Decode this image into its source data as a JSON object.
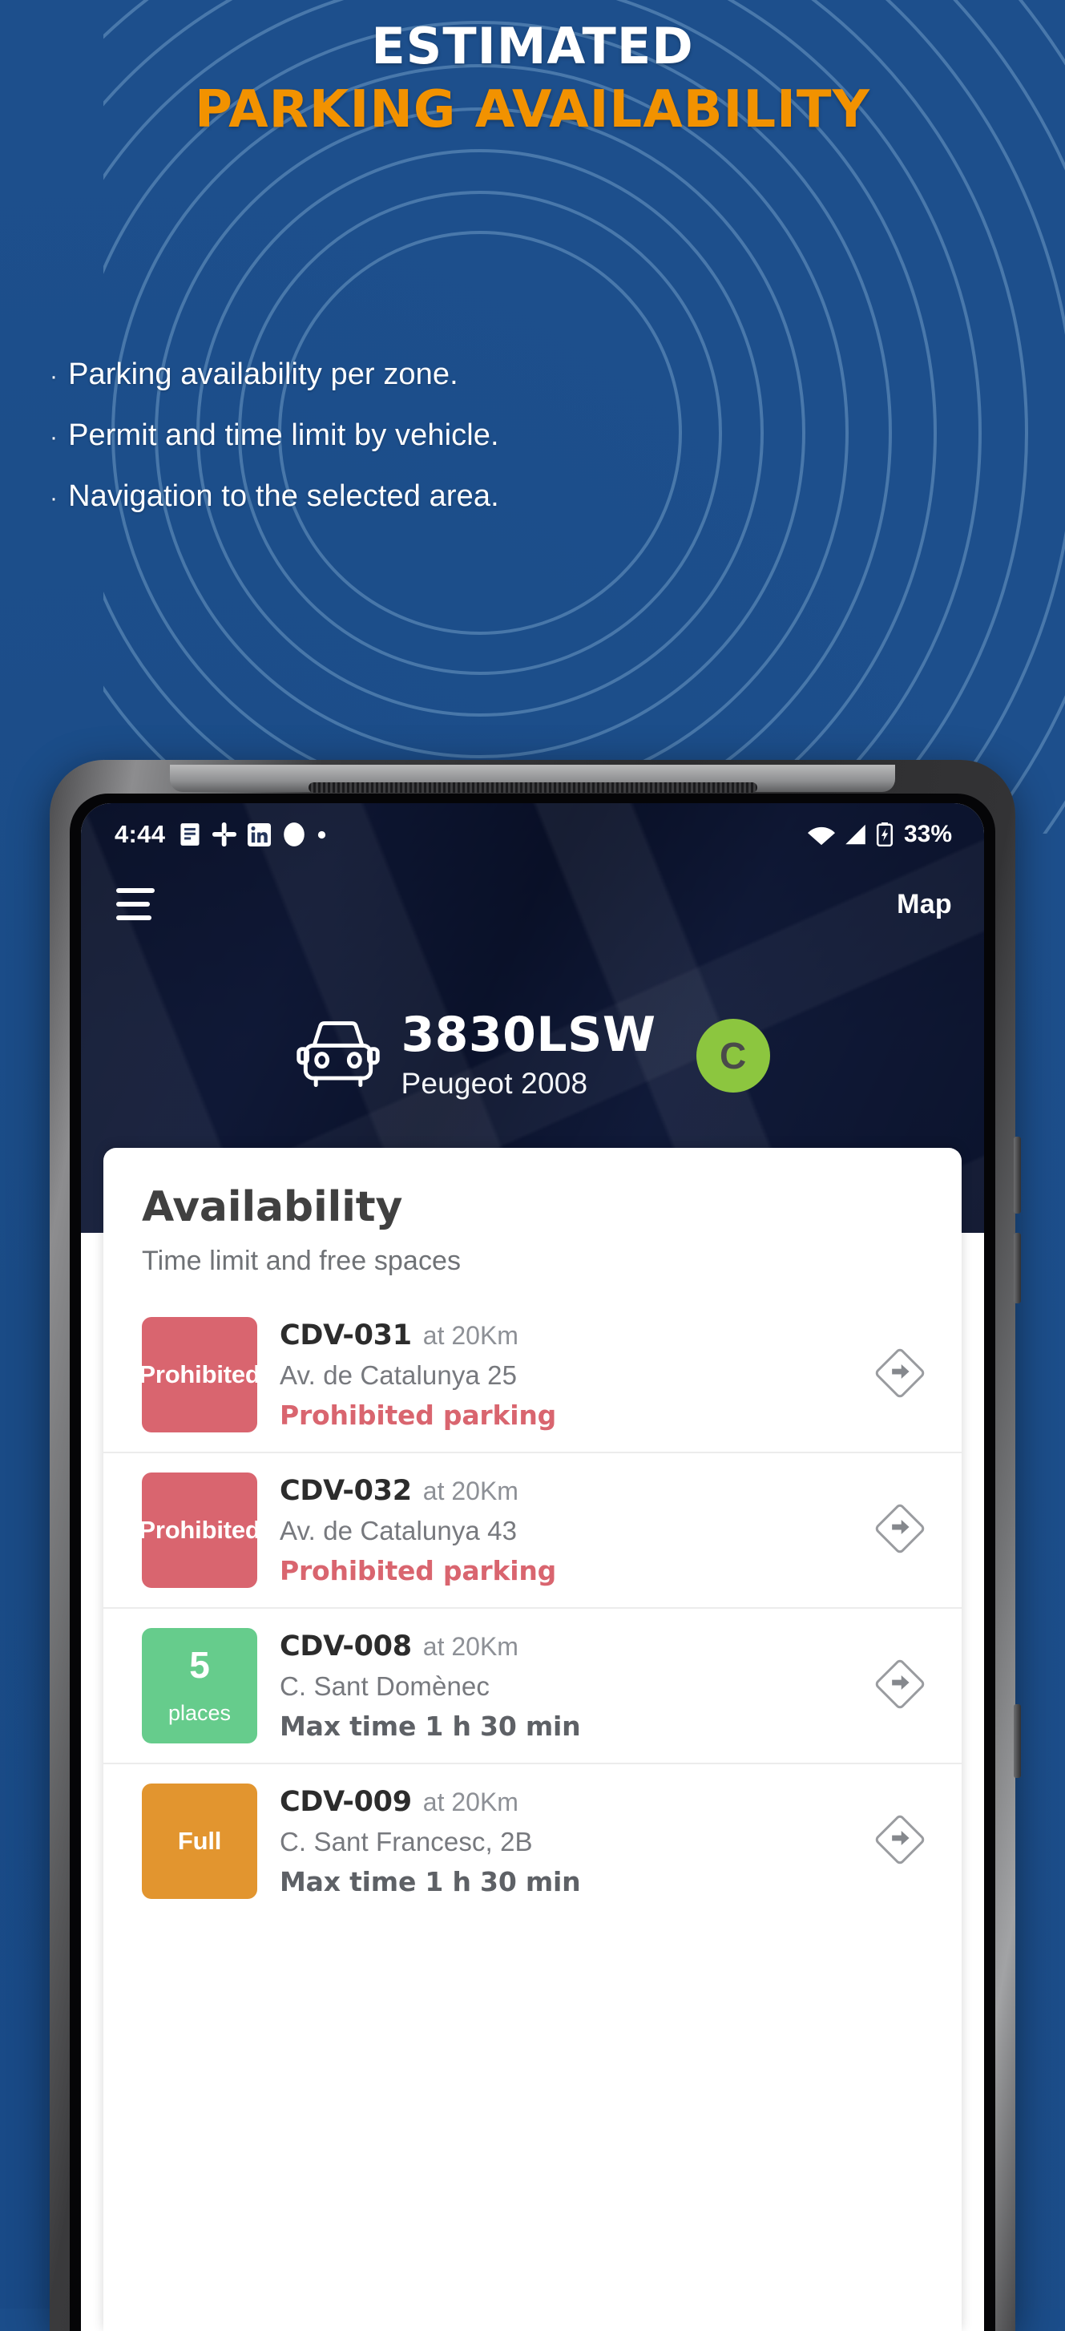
{
  "hero": {
    "line1": "ESTIMATED",
    "line2": "PARKING AVAILABILITY",
    "accent_color": "#f29200"
  },
  "bullets": [
    {
      "marker": "·",
      "text": "Parking availability per zone."
    },
    {
      "marker": "·",
      "text": "Permit and time limit by vehicle."
    },
    {
      "marker": "·",
      "text": "Navigation to the selected area."
    }
  ],
  "phone": {
    "statusbar": {
      "time": "4:44",
      "left_icons": [
        "notes-icon",
        "slack-icon",
        "linkedin-icon",
        "circle-icon",
        "dot-icon"
      ],
      "right_icons": [
        "wifi-icon",
        "signal-icon",
        "battery-charging-icon"
      ],
      "battery": "33%"
    },
    "appbar": {
      "menu_icon": "hamburger-icon",
      "action_label": "Map"
    },
    "vehicle": {
      "icon": "car-icon",
      "plate": "3830LSW",
      "model": "Peugeot 2008",
      "zone_letter": "C",
      "zone_color": "#8cc63f"
    },
    "sheet": {
      "title": "Availability",
      "subtitle": "Time limit and free spaces",
      "rows": [
        {
          "badge_kind": "label",
          "badge_label": "Prohibited",
          "badge_color": "#d9656f",
          "code": "CDV-031",
          "distance": "at 20Km",
          "address": "Av. de Catalunya 25",
          "status": "Prohibited parking",
          "status_kind": "prohibited",
          "nav_icon": "turn-right-diamond-icon"
        },
        {
          "badge_kind": "label",
          "badge_label": "Prohibited",
          "badge_color": "#d9656f",
          "code": "CDV-032",
          "distance": "at 20Km",
          "address": "Av. de Catalunya 43",
          "status": "Prohibited parking",
          "status_kind": "prohibited",
          "nav_icon": "turn-right-diamond-icon"
        },
        {
          "badge_kind": "count",
          "badge_number": "5",
          "badge_unit": "places",
          "badge_color": "#66cc8c",
          "code": "CDV-008",
          "distance": "at 20Km",
          "address": "C. Sant Domènec",
          "status": "Max time 1 h 30 min",
          "status_kind": "maxtime",
          "nav_icon": "turn-right-diamond-icon"
        },
        {
          "badge_kind": "label",
          "badge_label": "Full",
          "badge_color": "#e2952f",
          "code": "CDV-009",
          "distance": "at 20Km",
          "address": "C. Sant Francesc, 2B",
          "status": "Max time 1 h 30 min",
          "status_kind": "maxtime",
          "nav_icon": "turn-right-diamond-icon"
        }
      ]
    }
  }
}
